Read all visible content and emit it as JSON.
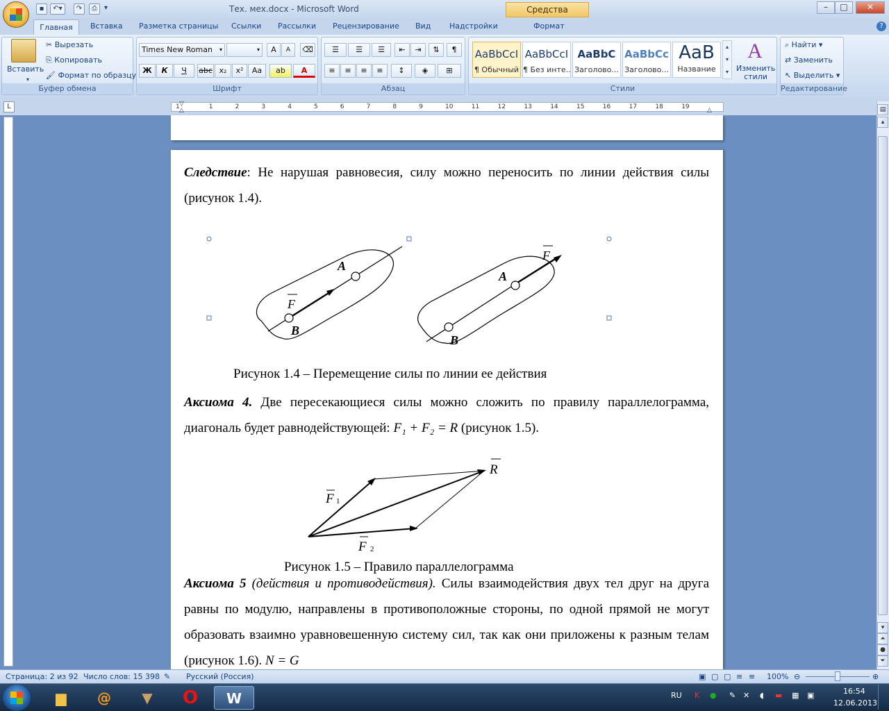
{
  "window": {
    "title": "Тех. мех.docx - Microsoft Word",
    "context_tab": "Средства рисования",
    "minimize": "–",
    "maximize": "□",
    "close": "✕"
  },
  "tabs": [
    "Главная",
    "Вставка",
    "Разметка страницы",
    "Ссылки",
    "Рассылки",
    "Рецензирование",
    "Вид",
    "Надстройки",
    "Формат"
  ],
  "ribbon": {
    "clipboard": {
      "label": "Буфер обмена",
      "paste": "Вставить",
      "cut": "Вырезать",
      "copy": "Копировать",
      "format_painter": "Формат по образцу"
    },
    "font": {
      "label": "Шрифт",
      "font_name": "Times New Roman",
      "font_size": "",
      "bold": "Ж",
      "italic": "К",
      "underline": "Ч",
      "strike": "abc",
      "subscript": "x₂",
      "superscript": "x²",
      "change_case": "Aa",
      "grow": "A",
      "shrink": "A"
    },
    "paragraph": {
      "label": "Абзац",
      "pilcrow": "¶"
    },
    "styles": {
      "label": "Стили",
      "items": [
        {
          "preview": "AaBbCcI",
          "name": "¶ Обычный"
        },
        {
          "preview": "AaBbCcI",
          "name": "¶ Без инте..."
        },
        {
          "preview": "AaBbC",
          "name": "Заголово..."
        },
        {
          "preview": "AaBbCc",
          "name": "Заголово..."
        },
        {
          "preview": "AaB",
          "name": "Название"
        }
      ],
      "change_styles": "Изменить стили"
    },
    "editing": {
      "label": "Редактирование",
      "find": "Найти",
      "replace": "Заменить",
      "select": "Выделить"
    }
  },
  "ruler_numbers": [
    "1",
    "1",
    "2",
    "3",
    "4",
    "5",
    "6",
    "7",
    "8",
    "9",
    "10",
    "11",
    "12",
    "13",
    "14",
    "15",
    "16",
    "17",
    "18",
    "19"
  ],
  "document": {
    "p1_bold_italic": "Следствие",
    "p1_text": ": Не нарушая равновесия, силу можно переносить по линии действия силы (рисунок 1.4).",
    "fig14_caption": "Рисунок 1.4 – Перемещение  силы по линии ее действия",
    "fig14_labels": {
      "A": "A",
      "B": "B",
      "F": "F"
    },
    "p2_bold_italic": "Аксиома  4.",
    "p2_text": " Две пересекающиеся силы можно сложить по правилу параллелограмма, диагональ будет равнодействующей: ",
    "p2_formula": "F₁ + F₂ = R",
    "p2_tail": " (рисунок 1.5).",
    "fig15_labels": {
      "R": "R",
      "F1": "F",
      "F1_sub": "1",
      "F2": "F",
      "F2_sub": "2"
    },
    "fig15_caption": "Рисунок 1.5 – Правило параллелограмма",
    "p3_bold_italic": "Аксиома 5",
    "p3_italic": " (действия и противодействия).",
    "p3_text": " Силы взаимодействия двух тел друг на друга равны по модулю, направлены в противоположные стороны, по одной прямой не могут образовать взаимно уравновешенную систему сил, так как они приложены к разным телам (рисунок 1.6). ",
    "p3_formula": "N = G"
  },
  "statusbar": {
    "page": "Страница: 2 из 92",
    "words": "Число слов: 15 398",
    "language": "Русский (Россия)",
    "zoom": "100%"
  },
  "taskbar": {
    "lang": "RU",
    "time": "16:54",
    "date": "12.06.2013"
  }
}
